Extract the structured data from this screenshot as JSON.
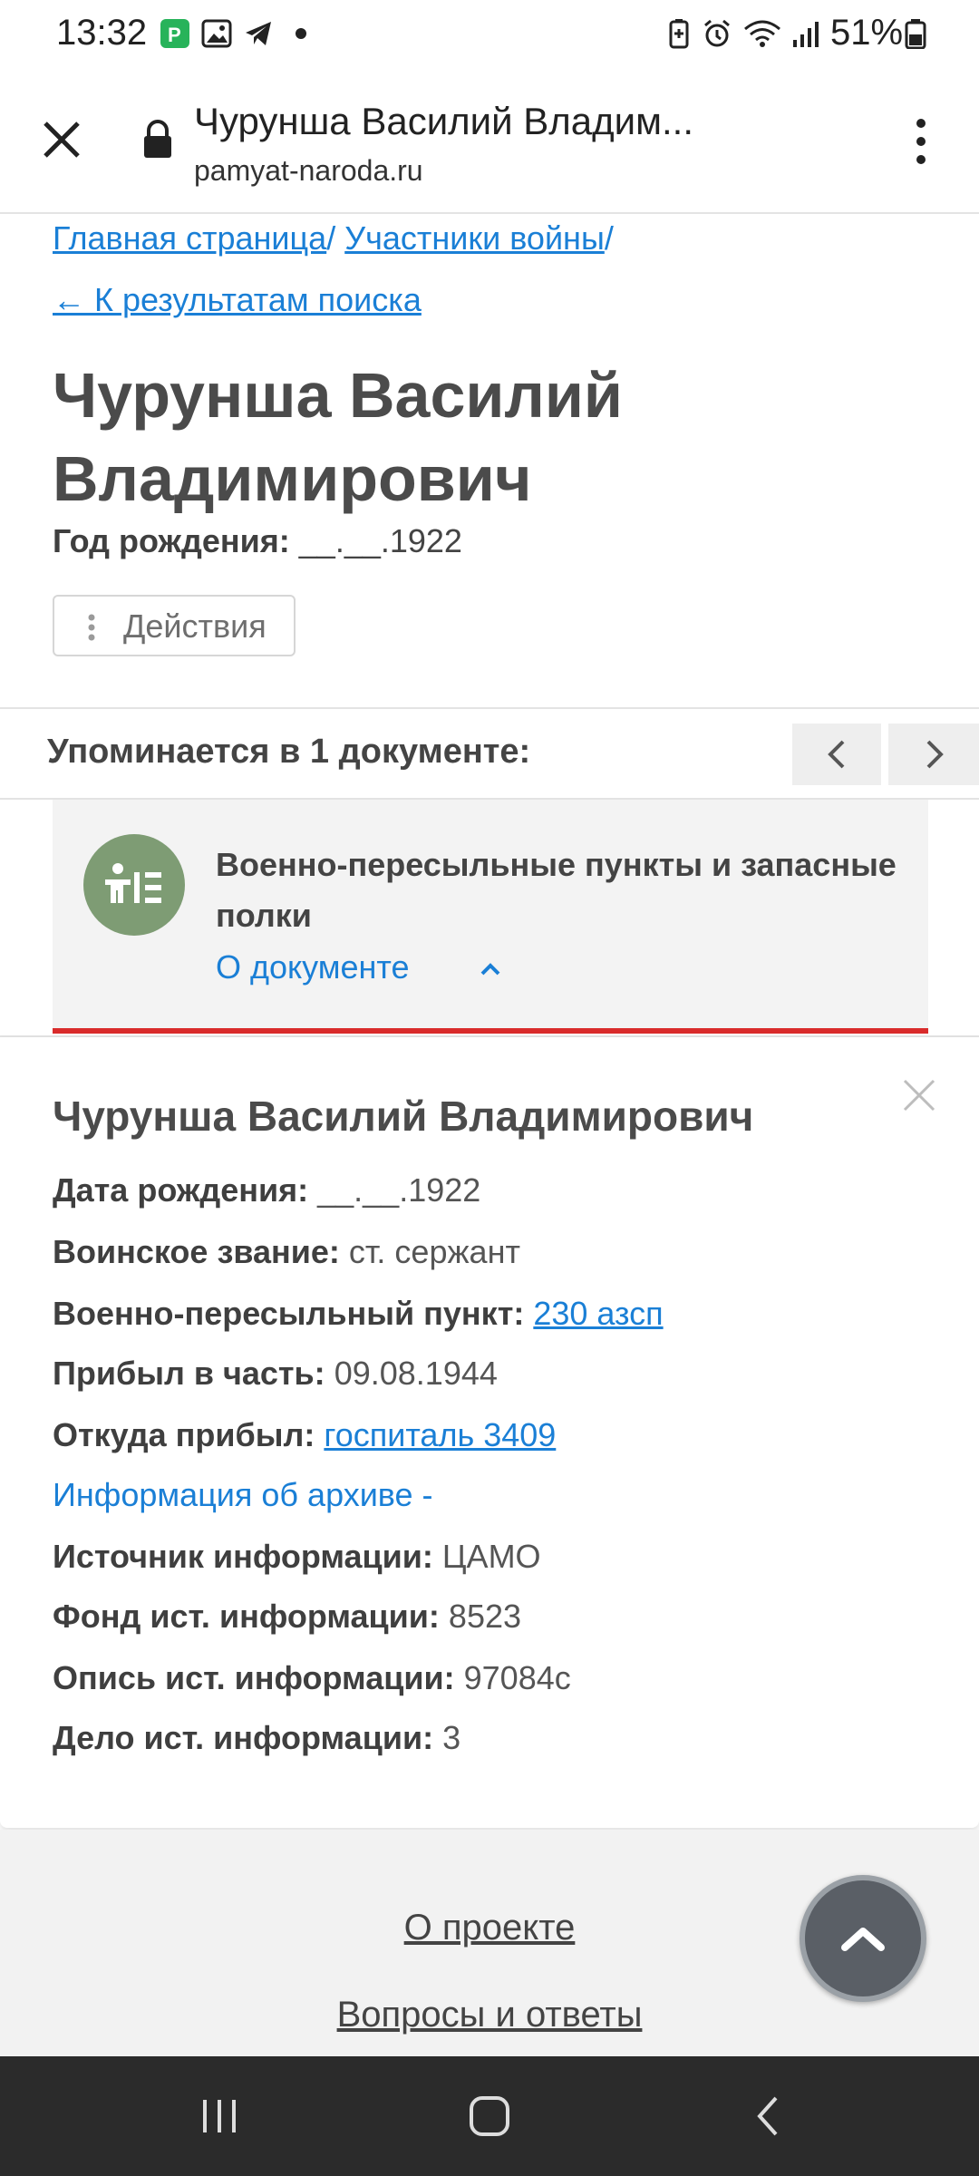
{
  "status_bar": {
    "time": "13:32",
    "battery": "51%",
    "icons_left": [
      "payment-app-icon",
      "gallery-icon",
      "telegram-icon",
      "dot-icon"
    ],
    "icons_right": [
      "battery-saver-icon",
      "alarm-icon",
      "wifi-icon",
      "signal-icon",
      "battery-icon"
    ]
  },
  "browser": {
    "title": "Чурунша Василий Владим...",
    "url": "pamyat-naroda.ru"
  },
  "breadcrumb": {
    "home": "Главная страница",
    "separator": "/",
    "participants": "Участники войны"
  },
  "back_link": "← К результатам поиска",
  "person": {
    "name": "Чурунша Василий Владимирович",
    "birth_label": "Год рождения:",
    "birth_value": "__.__.1922"
  },
  "actions_label": "Действия",
  "mentions": {
    "title": "Упоминается в 1 документе:"
  },
  "document": {
    "title": "Военно-пересыльные пункты и запасные полки",
    "about_link": "О документе",
    "accent_color": "#d92b2b",
    "avatar_color": "#7e9c74"
  },
  "details": {
    "name": "Чурунша Василий Владимирович",
    "birth_label": "Дата рождения:",
    "birth_value": "__.__.1922",
    "rank_label": "Воинское звание:",
    "rank_value": "ст. сержант",
    "transit_label": "Военно-пересыльный пункт:",
    "transit_value": "230 азсп",
    "arrived_label": "Прибыл в часть:",
    "arrived_value": "09.08.1944",
    "from_label": "Откуда прибыл:",
    "from_value": "госпиталь 3409",
    "archive_link": "Информация об архиве -",
    "source_label": "Источник информации:",
    "source_value": "ЦАМО",
    "fund_label": "Фонд ист. информации:",
    "fund_value": "8523",
    "inventory_label": "Опись ист. информации:",
    "inventory_value": "97084с",
    "case_label": "Дело ист. информации:",
    "case_value": "3"
  },
  "footer": {
    "about": "О проекте",
    "faq": "Вопросы и ответы"
  },
  "colors": {
    "link": "#1a7fd6",
    "text": "#4b4b4b"
  }
}
